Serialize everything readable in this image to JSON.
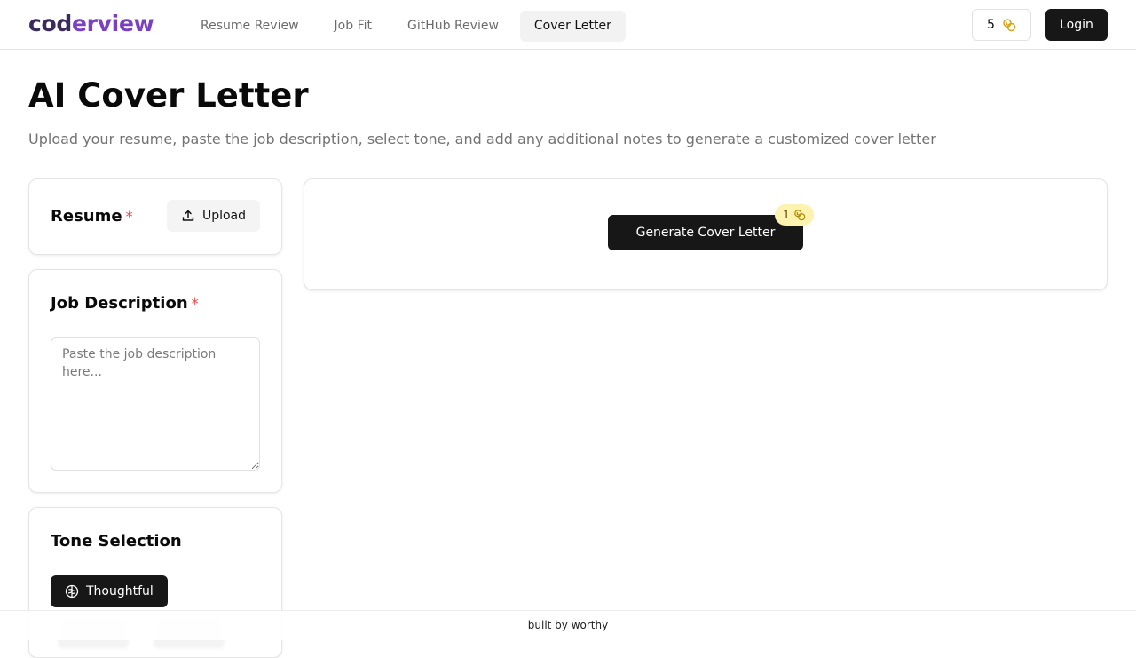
{
  "header": {
    "logo_part1": "cod",
    "logo_part2": "erview",
    "nav": [
      {
        "label": "Resume Review",
        "active": false
      },
      {
        "label": "Job Fit",
        "active": false
      },
      {
        "label": "GitHub Review",
        "active": false
      },
      {
        "label": "Cover Letter",
        "active": true
      }
    ],
    "credits": "5",
    "login_label": "Login"
  },
  "page": {
    "title": "AI Cover Letter",
    "subtitle": "Upload your resume, paste the job description, select tone, and add any additional notes to generate a customized cover letter"
  },
  "resume_card": {
    "title": "Resume",
    "required_mark": "*",
    "upload_label": "Upload"
  },
  "job_card": {
    "title": "Job Description",
    "required_mark": "*",
    "placeholder": "Paste the job description here...",
    "value": ""
  },
  "tone_card": {
    "title": "Tone Selection",
    "selected_tone": "Thoughtful"
  },
  "generate": {
    "label": "Generate Cover Letter",
    "cost": "1"
  },
  "footer": {
    "text": "built by worthy"
  },
  "colors": {
    "primary": "#171717",
    "logo_dark": "#3b2a5c",
    "logo_accent": "#7b3fc4",
    "required": "#ef4444",
    "coin": "#d4a017",
    "badge_bg": "#fdf3b0"
  },
  "icons": {
    "coin": "coins-icon",
    "upload": "upload-icon",
    "tone": "brain-icon"
  }
}
